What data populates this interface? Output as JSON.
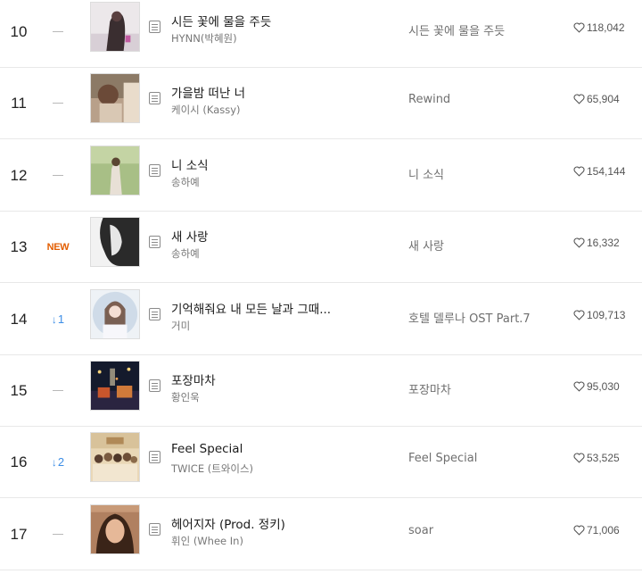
{
  "chart": {
    "rows": [
      {
        "rank": "10",
        "change_type": "same",
        "change_label": "",
        "title": "시든 꽃에 물을 주듯",
        "artist": "HYNN(박혜원)",
        "album": "시든 꽃에 물을 주듯",
        "likes": "118,042"
      },
      {
        "rank": "11",
        "change_type": "same",
        "change_label": "",
        "title": "가을밤 떠난 너",
        "artist": "케이시 (Kassy)",
        "album": "Rewind",
        "likes": "65,904"
      },
      {
        "rank": "12",
        "change_type": "same",
        "change_label": "",
        "title": "니 소식",
        "artist": "송하예",
        "album": "니 소식",
        "likes": "154,144"
      },
      {
        "rank": "13",
        "change_type": "new",
        "change_label": "NEW",
        "title": "새 사랑",
        "artist": "송하예",
        "album": "새 사랑",
        "likes": "16,332"
      },
      {
        "rank": "14",
        "change_type": "down",
        "change_label": "1",
        "title": "기억해줘요 내 모든 날과 그때...",
        "artist": "거미",
        "album": "호텔 델루나 OST Part.7",
        "likes": "109,713"
      },
      {
        "rank": "15",
        "change_type": "same",
        "change_label": "",
        "title": "포장마차",
        "artist": "황인욱",
        "album": "포장마차",
        "likes": "95,030"
      },
      {
        "rank": "16",
        "change_type": "down",
        "change_label": "2",
        "title": "Feel Special",
        "artist": "TWICE (트와이스)",
        "album": "Feel Special",
        "likes": "53,525"
      },
      {
        "rank": "17",
        "change_type": "same",
        "change_label": "",
        "title": "헤어지자 (Prod. 정키)",
        "artist": "휘인 (Whee In)",
        "album": "soar",
        "likes": "71,006"
      }
    ],
    "icons": {
      "lyrics": "lyrics-doc-icon",
      "like": "heart-outline-icon",
      "rank_down": "arrow-down-icon",
      "rank_same": "dash-icon"
    },
    "colors": {
      "new_badge": "#e35d00",
      "rank_down": "#3d8ee6",
      "divider": "#e8e8e8"
    }
  }
}
